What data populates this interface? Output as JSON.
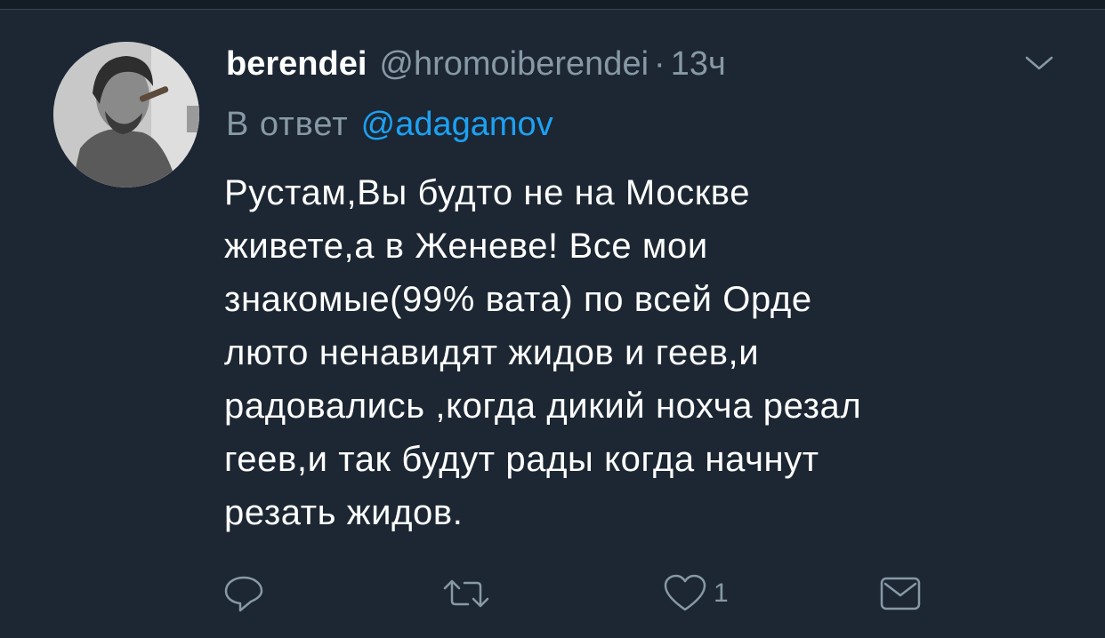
{
  "tweet": {
    "author_name": "berendei",
    "author_handle": "@hromoiberendei",
    "separator": "·",
    "time": "13ч",
    "reply_prefix": "В ответ",
    "reply_mention": "@adagamov",
    "text_lines": [
      "Рустам,Вы будто не на Москве",
      "живете,а в Женеве! Все мои",
      "знакомые(99% вата) по всей Орде",
      "люто ненавидят жидов и геев,и",
      "радовались ,когда дикий нохча резал",
      "геев,и так будут рады когда начнут",
      "резать жидов."
    ],
    "like_count": "1"
  },
  "icons": {
    "reply": "reply-icon",
    "retweet": "retweet-icon",
    "like": "heart-icon",
    "dm": "envelope-icon",
    "menu": "chevron-down-icon"
  },
  "colors": {
    "background": "#1c2733",
    "text": "#ffffff",
    "secondary": "#8899a6",
    "link": "#1da1f2"
  }
}
